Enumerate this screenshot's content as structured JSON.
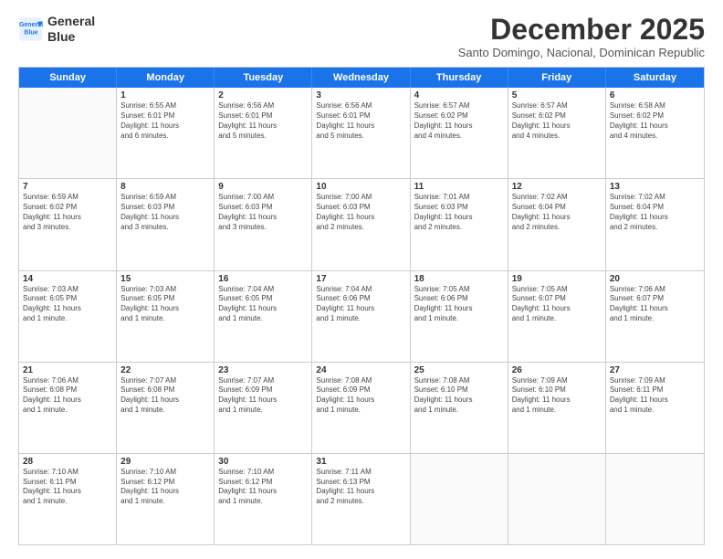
{
  "header": {
    "logo_line1": "General",
    "logo_line2": "Blue",
    "month_title": "December 2025",
    "location": "Santo Domingo, Nacional, Dominican Republic"
  },
  "days_of_week": [
    "Sunday",
    "Monday",
    "Tuesday",
    "Wednesday",
    "Thursday",
    "Friday",
    "Saturday"
  ],
  "weeks": [
    [
      {
        "day": "",
        "info": ""
      },
      {
        "day": "1",
        "info": "Sunrise: 6:55 AM\nSunset: 6:01 PM\nDaylight: 11 hours\nand 6 minutes."
      },
      {
        "day": "2",
        "info": "Sunrise: 6:56 AM\nSunset: 6:01 PM\nDaylight: 11 hours\nand 5 minutes."
      },
      {
        "day": "3",
        "info": "Sunrise: 6:56 AM\nSunset: 6:01 PM\nDaylight: 11 hours\nand 5 minutes."
      },
      {
        "day": "4",
        "info": "Sunrise: 6:57 AM\nSunset: 6:02 PM\nDaylight: 11 hours\nand 4 minutes."
      },
      {
        "day": "5",
        "info": "Sunrise: 6:57 AM\nSunset: 6:02 PM\nDaylight: 11 hours\nand 4 minutes."
      },
      {
        "day": "6",
        "info": "Sunrise: 6:58 AM\nSunset: 6:02 PM\nDaylight: 11 hours\nand 4 minutes."
      }
    ],
    [
      {
        "day": "7",
        "info": "Sunrise: 6:59 AM\nSunset: 6:02 PM\nDaylight: 11 hours\nand 3 minutes."
      },
      {
        "day": "8",
        "info": "Sunrise: 6:59 AM\nSunset: 6:03 PM\nDaylight: 11 hours\nand 3 minutes."
      },
      {
        "day": "9",
        "info": "Sunrise: 7:00 AM\nSunset: 6:03 PM\nDaylight: 11 hours\nand 3 minutes."
      },
      {
        "day": "10",
        "info": "Sunrise: 7:00 AM\nSunset: 6:03 PM\nDaylight: 11 hours\nand 2 minutes."
      },
      {
        "day": "11",
        "info": "Sunrise: 7:01 AM\nSunset: 6:03 PM\nDaylight: 11 hours\nand 2 minutes."
      },
      {
        "day": "12",
        "info": "Sunrise: 7:02 AM\nSunset: 6:04 PM\nDaylight: 11 hours\nand 2 minutes."
      },
      {
        "day": "13",
        "info": "Sunrise: 7:02 AM\nSunset: 6:04 PM\nDaylight: 11 hours\nand 2 minutes."
      }
    ],
    [
      {
        "day": "14",
        "info": "Sunrise: 7:03 AM\nSunset: 6:05 PM\nDaylight: 11 hours\nand 1 minute."
      },
      {
        "day": "15",
        "info": "Sunrise: 7:03 AM\nSunset: 6:05 PM\nDaylight: 11 hours\nand 1 minute."
      },
      {
        "day": "16",
        "info": "Sunrise: 7:04 AM\nSunset: 6:05 PM\nDaylight: 11 hours\nand 1 minute."
      },
      {
        "day": "17",
        "info": "Sunrise: 7:04 AM\nSunset: 6:06 PM\nDaylight: 11 hours\nand 1 minute."
      },
      {
        "day": "18",
        "info": "Sunrise: 7:05 AM\nSunset: 6:06 PM\nDaylight: 11 hours\nand 1 minute."
      },
      {
        "day": "19",
        "info": "Sunrise: 7:05 AM\nSunset: 6:07 PM\nDaylight: 11 hours\nand 1 minute."
      },
      {
        "day": "20",
        "info": "Sunrise: 7:06 AM\nSunset: 6:07 PM\nDaylight: 11 hours\nand 1 minute."
      }
    ],
    [
      {
        "day": "21",
        "info": "Sunrise: 7:06 AM\nSunset: 6:08 PM\nDaylight: 11 hours\nand 1 minute."
      },
      {
        "day": "22",
        "info": "Sunrise: 7:07 AM\nSunset: 6:08 PM\nDaylight: 11 hours\nand 1 minute."
      },
      {
        "day": "23",
        "info": "Sunrise: 7:07 AM\nSunset: 6:09 PM\nDaylight: 11 hours\nand 1 minute."
      },
      {
        "day": "24",
        "info": "Sunrise: 7:08 AM\nSunset: 6:09 PM\nDaylight: 11 hours\nand 1 minute."
      },
      {
        "day": "25",
        "info": "Sunrise: 7:08 AM\nSunset: 6:10 PM\nDaylight: 11 hours\nand 1 minute."
      },
      {
        "day": "26",
        "info": "Sunrise: 7:09 AM\nSunset: 6:10 PM\nDaylight: 11 hours\nand 1 minute."
      },
      {
        "day": "27",
        "info": "Sunrise: 7:09 AM\nSunset: 6:11 PM\nDaylight: 11 hours\nand 1 minute."
      }
    ],
    [
      {
        "day": "28",
        "info": "Sunrise: 7:10 AM\nSunset: 6:11 PM\nDaylight: 11 hours\nand 1 minute."
      },
      {
        "day": "29",
        "info": "Sunrise: 7:10 AM\nSunset: 6:12 PM\nDaylight: 11 hours\nand 1 minute."
      },
      {
        "day": "30",
        "info": "Sunrise: 7:10 AM\nSunset: 6:12 PM\nDaylight: 11 hours\nand 1 minute."
      },
      {
        "day": "31",
        "info": "Sunrise: 7:11 AM\nSunset: 6:13 PM\nDaylight: 11 hours\nand 2 minutes."
      },
      {
        "day": "",
        "info": ""
      },
      {
        "day": "",
        "info": ""
      },
      {
        "day": "",
        "info": ""
      }
    ]
  ]
}
